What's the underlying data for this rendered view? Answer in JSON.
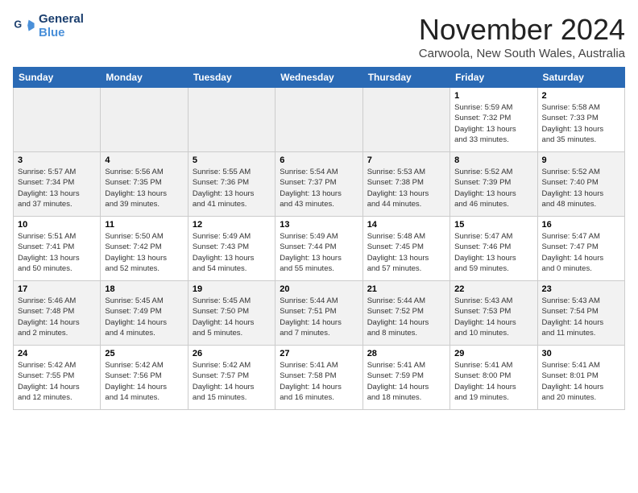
{
  "header": {
    "logo_line1": "General",
    "logo_line2": "Blue",
    "title": "November 2024",
    "subtitle": "Carwoola, New South Wales, Australia"
  },
  "columns": [
    "Sunday",
    "Monday",
    "Tuesday",
    "Wednesday",
    "Thursday",
    "Friday",
    "Saturday"
  ],
  "weeks": [
    [
      {
        "day": "",
        "info": ""
      },
      {
        "day": "",
        "info": ""
      },
      {
        "day": "",
        "info": ""
      },
      {
        "day": "",
        "info": ""
      },
      {
        "day": "",
        "info": ""
      },
      {
        "day": "1",
        "info": "Sunrise: 5:59 AM\nSunset: 7:32 PM\nDaylight: 13 hours\nand 33 minutes."
      },
      {
        "day": "2",
        "info": "Sunrise: 5:58 AM\nSunset: 7:33 PM\nDaylight: 13 hours\nand 35 minutes."
      }
    ],
    [
      {
        "day": "3",
        "info": "Sunrise: 5:57 AM\nSunset: 7:34 PM\nDaylight: 13 hours\nand 37 minutes."
      },
      {
        "day": "4",
        "info": "Sunrise: 5:56 AM\nSunset: 7:35 PM\nDaylight: 13 hours\nand 39 minutes."
      },
      {
        "day": "5",
        "info": "Sunrise: 5:55 AM\nSunset: 7:36 PM\nDaylight: 13 hours\nand 41 minutes."
      },
      {
        "day": "6",
        "info": "Sunrise: 5:54 AM\nSunset: 7:37 PM\nDaylight: 13 hours\nand 43 minutes."
      },
      {
        "day": "7",
        "info": "Sunrise: 5:53 AM\nSunset: 7:38 PM\nDaylight: 13 hours\nand 44 minutes."
      },
      {
        "day": "8",
        "info": "Sunrise: 5:52 AM\nSunset: 7:39 PM\nDaylight: 13 hours\nand 46 minutes."
      },
      {
        "day": "9",
        "info": "Sunrise: 5:52 AM\nSunset: 7:40 PM\nDaylight: 13 hours\nand 48 minutes."
      }
    ],
    [
      {
        "day": "10",
        "info": "Sunrise: 5:51 AM\nSunset: 7:41 PM\nDaylight: 13 hours\nand 50 minutes."
      },
      {
        "day": "11",
        "info": "Sunrise: 5:50 AM\nSunset: 7:42 PM\nDaylight: 13 hours\nand 52 minutes."
      },
      {
        "day": "12",
        "info": "Sunrise: 5:49 AM\nSunset: 7:43 PM\nDaylight: 13 hours\nand 54 minutes."
      },
      {
        "day": "13",
        "info": "Sunrise: 5:49 AM\nSunset: 7:44 PM\nDaylight: 13 hours\nand 55 minutes."
      },
      {
        "day": "14",
        "info": "Sunrise: 5:48 AM\nSunset: 7:45 PM\nDaylight: 13 hours\nand 57 minutes."
      },
      {
        "day": "15",
        "info": "Sunrise: 5:47 AM\nSunset: 7:46 PM\nDaylight: 13 hours\nand 59 minutes."
      },
      {
        "day": "16",
        "info": "Sunrise: 5:47 AM\nSunset: 7:47 PM\nDaylight: 14 hours\nand 0 minutes."
      }
    ],
    [
      {
        "day": "17",
        "info": "Sunrise: 5:46 AM\nSunset: 7:48 PM\nDaylight: 14 hours\nand 2 minutes."
      },
      {
        "day": "18",
        "info": "Sunrise: 5:45 AM\nSunset: 7:49 PM\nDaylight: 14 hours\nand 4 minutes."
      },
      {
        "day": "19",
        "info": "Sunrise: 5:45 AM\nSunset: 7:50 PM\nDaylight: 14 hours\nand 5 minutes."
      },
      {
        "day": "20",
        "info": "Sunrise: 5:44 AM\nSunset: 7:51 PM\nDaylight: 14 hours\nand 7 minutes."
      },
      {
        "day": "21",
        "info": "Sunrise: 5:44 AM\nSunset: 7:52 PM\nDaylight: 14 hours\nand 8 minutes."
      },
      {
        "day": "22",
        "info": "Sunrise: 5:43 AM\nSunset: 7:53 PM\nDaylight: 14 hours\nand 10 minutes."
      },
      {
        "day": "23",
        "info": "Sunrise: 5:43 AM\nSunset: 7:54 PM\nDaylight: 14 hours\nand 11 minutes."
      }
    ],
    [
      {
        "day": "24",
        "info": "Sunrise: 5:42 AM\nSunset: 7:55 PM\nDaylight: 14 hours\nand 12 minutes."
      },
      {
        "day": "25",
        "info": "Sunrise: 5:42 AM\nSunset: 7:56 PM\nDaylight: 14 hours\nand 14 minutes."
      },
      {
        "day": "26",
        "info": "Sunrise: 5:42 AM\nSunset: 7:57 PM\nDaylight: 14 hours\nand 15 minutes."
      },
      {
        "day": "27",
        "info": "Sunrise: 5:41 AM\nSunset: 7:58 PM\nDaylight: 14 hours\nand 16 minutes."
      },
      {
        "day": "28",
        "info": "Sunrise: 5:41 AM\nSunset: 7:59 PM\nDaylight: 14 hours\nand 18 minutes."
      },
      {
        "day": "29",
        "info": "Sunrise: 5:41 AM\nSunset: 8:00 PM\nDaylight: 14 hours\nand 19 minutes."
      },
      {
        "day": "30",
        "info": "Sunrise: 5:41 AM\nSunset: 8:01 PM\nDaylight: 14 hours\nand 20 minutes."
      }
    ]
  ]
}
